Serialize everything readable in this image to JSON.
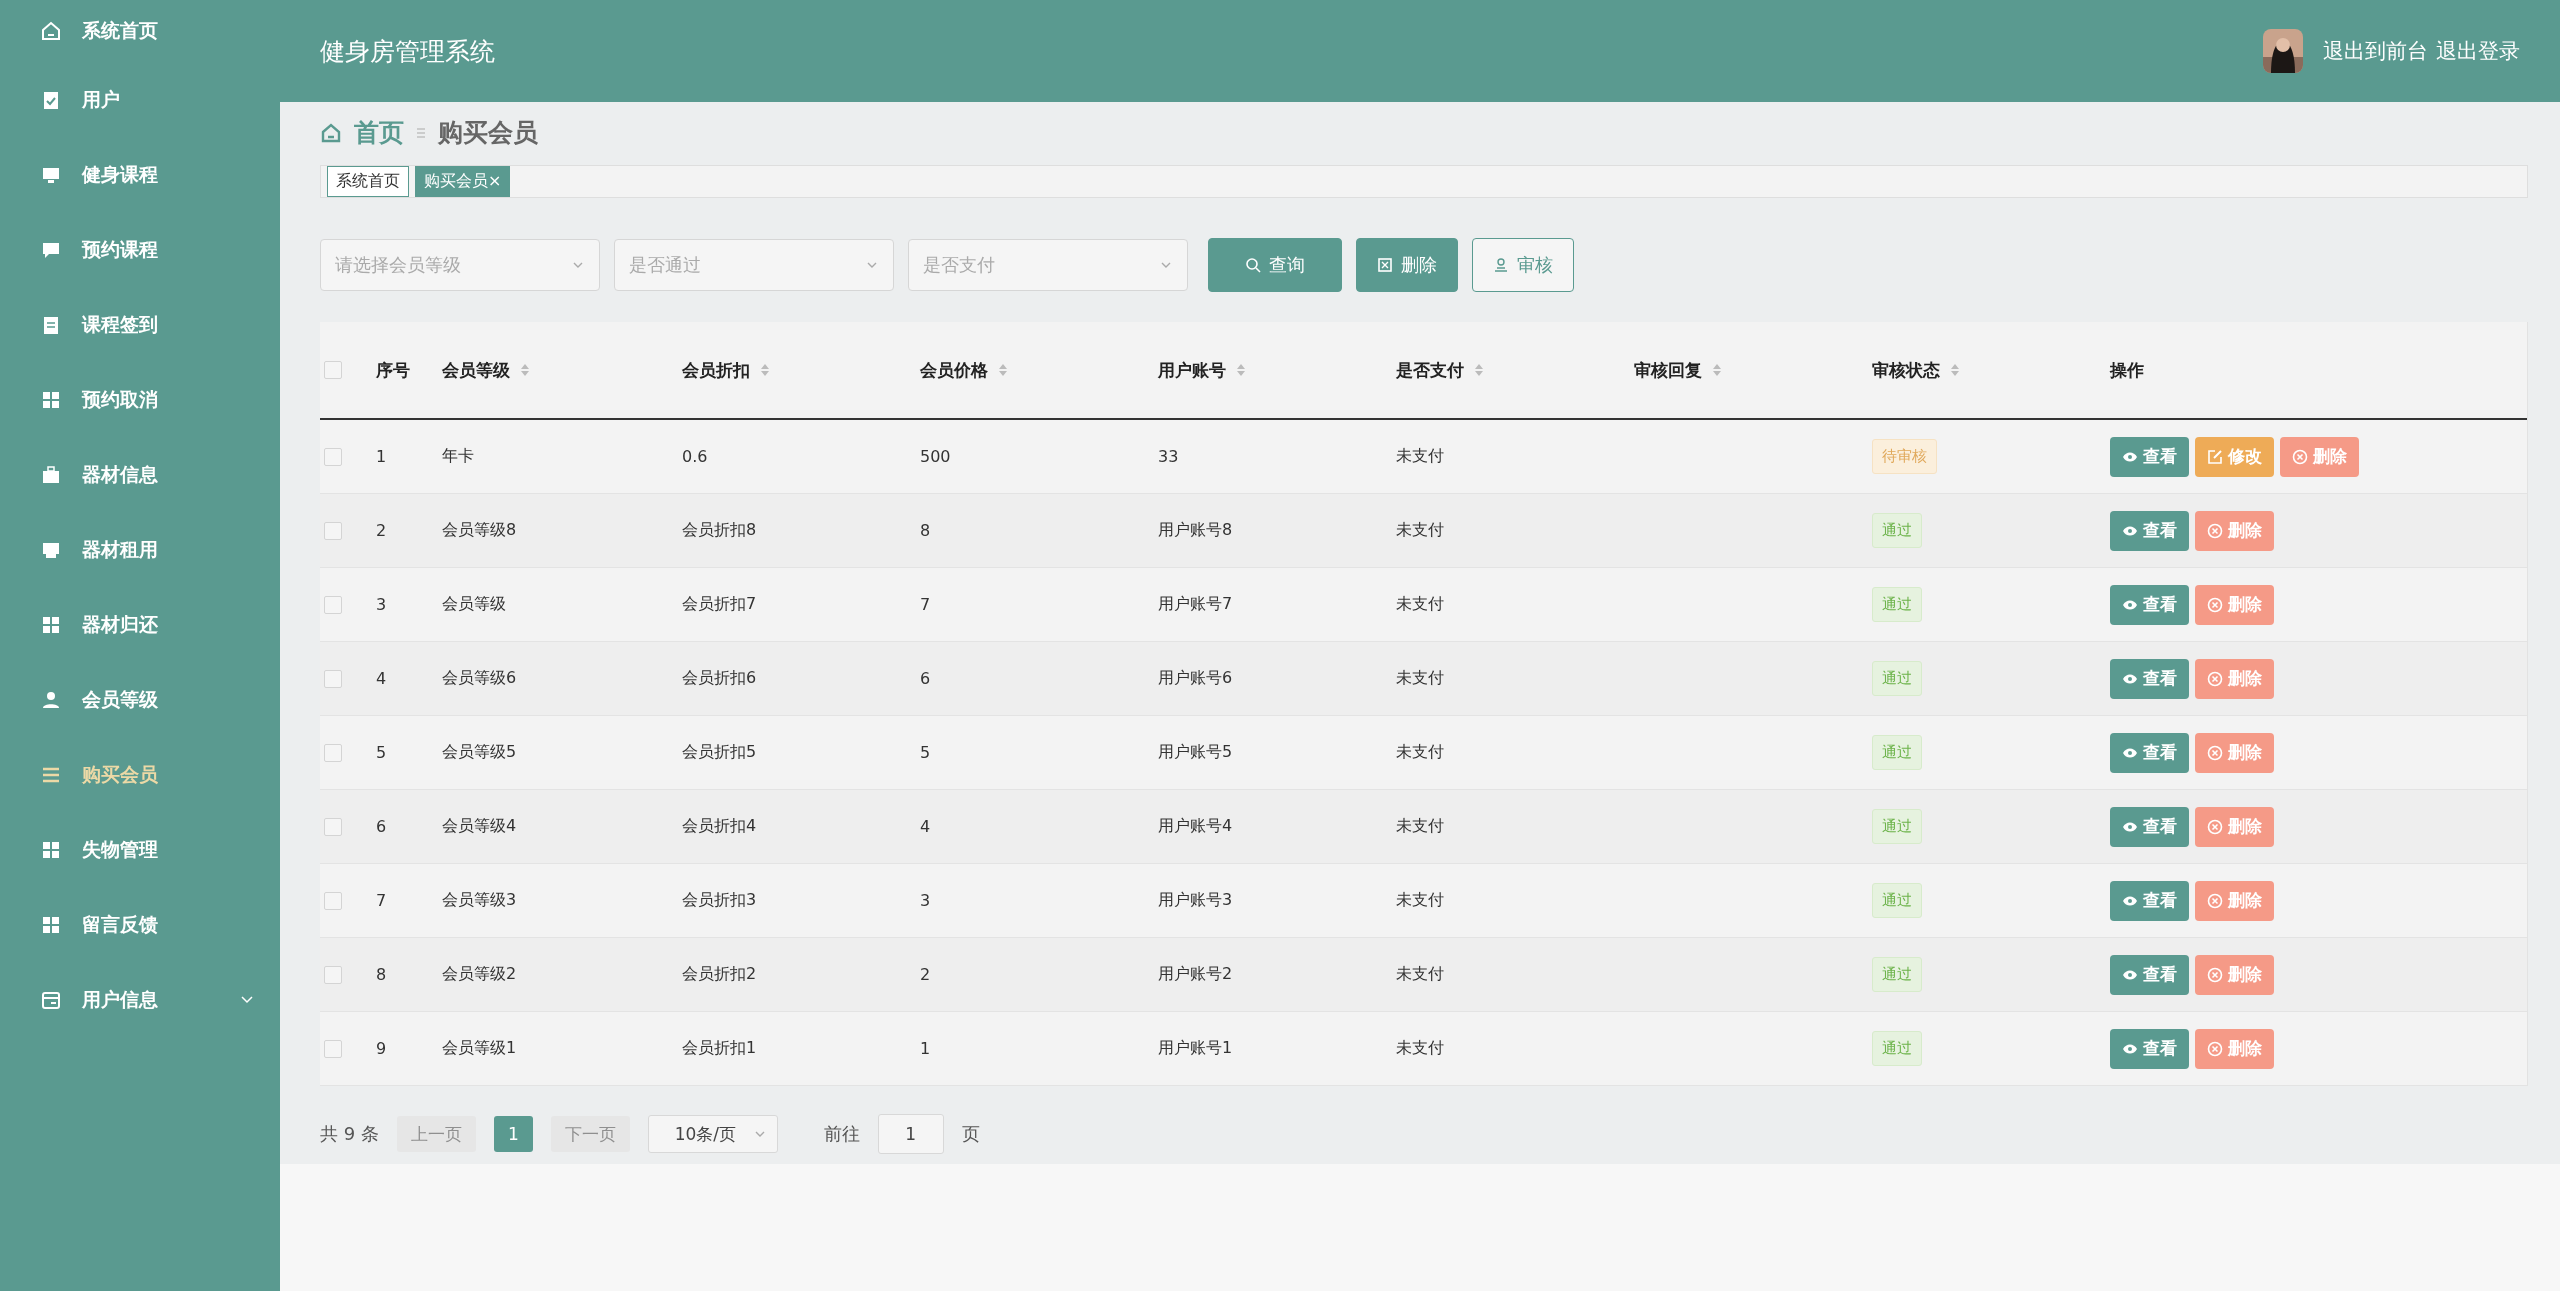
{
  "sidebar": {
    "items": [
      {
        "label": "系统首页",
        "selected": false
      },
      {
        "label": "用户",
        "selected": false
      },
      {
        "label": "健身课程",
        "selected": false
      },
      {
        "label": "预约课程",
        "selected": false
      },
      {
        "label": "课程签到",
        "selected": false
      },
      {
        "label": "预约取消",
        "selected": false
      },
      {
        "label": "器材信息",
        "selected": false
      },
      {
        "label": "器材租用",
        "selected": false
      },
      {
        "label": "器材归还",
        "selected": false
      },
      {
        "label": "会员等级",
        "selected": false
      },
      {
        "label": "购买会员",
        "selected": true
      },
      {
        "label": "失物管理",
        "selected": false
      },
      {
        "label": "留言反馈",
        "selected": false
      },
      {
        "label": "用户信息",
        "selected": false,
        "expanded": false
      }
    ]
  },
  "header": {
    "title": "健身房管理系统",
    "links": [
      "退出到前台",
      "退出登录"
    ]
  },
  "breadcrumb": [
    "首页",
    "购买会员"
  ],
  "tags": [
    {
      "label": "系统首页",
      "selected": false
    },
    {
      "label": "购买会员",
      "selected": true,
      "close": "×"
    }
  ],
  "filters": {
    "selects": [
      {
        "placeholder": "请选择会员等级"
      },
      {
        "placeholder": "是否通过"
      },
      {
        "placeholder": "是否支付"
      }
    ],
    "buttons": [
      {
        "label": "查询",
        "kind": "search"
      },
      {
        "label": "删除",
        "kind": "delete"
      },
      {
        "label": "审核",
        "kind": "audit"
      }
    ]
  },
  "table": {
    "columns": [
      {
        "label": "序号",
        "sortable": false
      },
      {
        "label": "会员等级",
        "sortable": true
      },
      {
        "label": "会员折扣",
        "sortable": true
      },
      {
        "label": "会员价格",
        "sortable": true
      },
      {
        "label": "用户账号",
        "sortable": true
      },
      {
        "label": "是否支付",
        "sortable": true
      },
      {
        "label": "审核回复",
        "sortable": true
      },
      {
        "label": "审核状态",
        "sortable": true
      },
      {
        "label": "操作",
        "sortable": false
      }
    ],
    "header_checked": false,
    "rows": [
      {
        "checked": false,
        "cells": [
          "1",
          "年卡",
          "0.6",
          "500",
          "33",
          "未支付",
          ""
        ],
        "status": {
          "label": "待审核",
          "kind": "pending"
        },
        "actions": [
          {
            "label": "查看",
            "kind": "view"
          },
          {
            "label": "修改",
            "kind": "edit"
          },
          {
            "label": "删除",
            "kind": "delete"
          }
        ]
      },
      {
        "checked": false,
        "cells": [
          "2",
          "会员等级8",
          "会员折扣8",
          "8",
          "用户账号8",
          "未支付",
          ""
        ],
        "status": {
          "label": "通过",
          "kind": "passed"
        },
        "actions": [
          {
            "label": "查看",
            "kind": "view"
          },
          {
            "label": "删除",
            "kind": "delete"
          }
        ]
      },
      {
        "checked": false,
        "cells": [
          "3",
          "会员等级",
          "会员折扣7",
          "7",
          "用户账号7",
          "未支付",
          ""
        ],
        "status": {
          "label": "通过",
          "kind": "passed"
        },
        "actions": [
          {
            "label": "查看",
            "kind": "view"
          },
          {
            "label": "删除",
            "kind": "delete"
          }
        ]
      },
      {
        "checked": false,
        "cells": [
          "4",
          "会员等级6",
          "会员折扣6",
          "6",
          "用户账号6",
          "未支付",
          ""
        ],
        "status": {
          "label": "通过",
          "kind": "passed"
        },
        "actions": [
          {
            "label": "查看",
            "kind": "view"
          },
          {
            "label": "删除",
            "kind": "delete"
          }
        ]
      },
      {
        "checked": false,
        "cells": [
          "5",
          "会员等级5",
          "会员折扣5",
          "5",
          "用户账号5",
          "未支付",
          ""
        ],
        "status": {
          "label": "通过",
          "kind": "passed"
        },
        "actions": [
          {
            "label": "查看",
            "kind": "view"
          },
          {
            "label": "删除",
            "kind": "delete"
          }
        ]
      },
      {
        "checked": false,
        "cells": [
          "6",
          "会员等级4",
          "会员折扣4",
          "4",
          "用户账号4",
          "未支付",
          ""
        ],
        "status": {
          "label": "通过",
          "kind": "passed"
        },
        "actions": [
          {
            "label": "查看",
            "kind": "view"
          },
          {
            "label": "删除",
            "kind": "delete"
          }
        ]
      },
      {
        "checked": false,
        "cells": [
          "7",
          "会员等级3",
          "会员折扣3",
          "3",
          "用户账号3",
          "未支付",
          ""
        ],
        "status": {
          "label": "通过",
          "kind": "passed"
        },
        "actions": [
          {
            "label": "查看",
            "kind": "view"
          },
          {
            "label": "删除",
            "kind": "delete"
          }
        ]
      },
      {
        "checked": false,
        "cells": [
          "8",
          "会员等级2",
          "会员折扣2",
          "2",
          "用户账号2",
          "未支付",
          ""
        ],
        "status": {
          "label": "通过",
          "kind": "passed"
        },
        "actions": [
          {
            "label": "查看",
            "kind": "view"
          },
          {
            "label": "删除",
            "kind": "delete"
          }
        ]
      },
      {
        "checked": false,
        "cells": [
          "9",
          "会员等级1",
          "会员折扣1",
          "1",
          "用户账号1",
          "未支付",
          ""
        ],
        "status": {
          "label": "通过",
          "kind": "passed"
        },
        "actions": [
          {
            "label": "查看",
            "kind": "view"
          },
          {
            "label": "删除",
            "kind": "delete"
          }
        ]
      }
    ]
  },
  "pagination": {
    "total": "共 9 条",
    "prev": "上一页",
    "pages": [
      {
        "label": "1",
        "selected": true
      }
    ],
    "next": "下一页",
    "page_size": "10条/页",
    "goto_label": "前往",
    "goto_value": "1",
    "page_unit": "页"
  }
}
